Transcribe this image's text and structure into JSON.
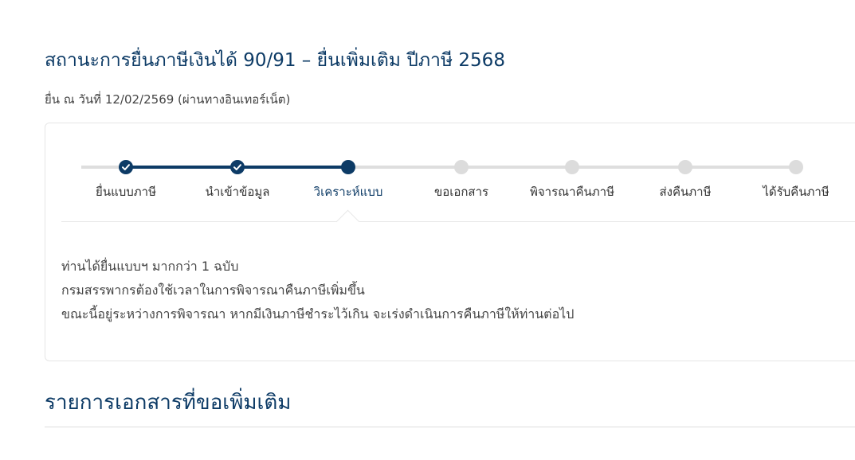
{
  "header": {
    "title": "สถานะการยื่นภาษีเงินได้ 90/91 – ยื่นเพิ่มเติม ปีภาษี 2568",
    "subtitle": "ยื่น ณ วันที่ 12/02/2569 (ผ่านทางอินเทอร์เน็ต)"
  },
  "progress": {
    "steps": [
      {
        "label": "ยื่นแบบภาษี",
        "state": "done"
      },
      {
        "label": "นำเข้าข้อมูล",
        "state": "done"
      },
      {
        "label": "วิเคราะห์แบบ",
        "state": "current"
      },
      {
        "label": "ขอเอกสาร",
        "state": "pending"
      },
      {
        "label": "พิจารณาคืนภาษี",
        "state": "pending"
      },
      {
        "label": "ส่งคืนภาษี",
        "state": "pending"
      },
      {
        "label": "ได้รับคืนภาษี",
        "state": "pending"
      }
    ],
    "completed_icon": "check-icon",
    "colors": {
      "active": "#0d3b66",
      "pending": "#dcdcdc"
    }
  },
  "message": {
    "lines": [
      "ท่านได้ยื่นแบบฯ มากกว่า 1 ฉบับ",
      "กรมสรรพากรต้องใช้เวลาในการพิจารณาคืนภาษีเพิ่มขึ้น",
      "ขณะนี้อยู่ระหว่างการพิจารณา หากมีเงินภาษีชำระไว้เกิน จะเร่งดำเนินการคืนภาษีให้ท่านต่อไป"
    ]
  },
  "documents_section": {
    "title": "รายการเอกสารที่ขอเพิ่มเติม"
  }
}
